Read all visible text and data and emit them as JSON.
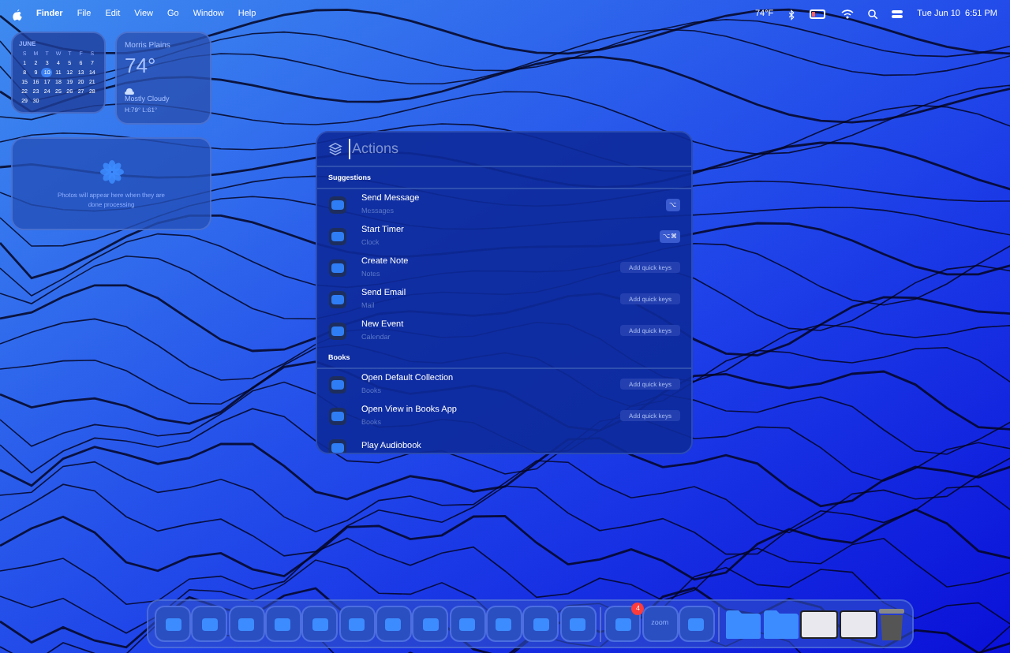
{
  "menu_bar": {
    "menus": [
      "Finder",
      "File",
      "Edit",
      "View",
      "Go",
      "Window",
      "Help"
    ],
    "weather": "74°F",
    "clock": "Tue Jun 10  6:51 PM"
  },
  "calendar_widget": {
    "month": "JUNE",
    "weekdays": [
      "S",
      "M",
      "T",
      "W",
      "T",
      "F",
      "S"
    ],
    "days": [
      {
        "label": "1",
        "selected": false
      },
      {
        "label": "2",
        "selected": false
      },
      {
        "label": "3",
        "selected": false
      },
      {
        "label": "4",
        "selected": false
      },
      {
        "label": "5",
        "selected": false
      },
      {
        "label": "6",
        "selected": false
      },
      {
        "label": "7",
        "selected": false
      },
      {
        "label": "8",
        "selected": false
      },
      {
        "label": "9",
        "selected": false
      },
      {
        "label": "10",
        "selected": true
      },
      {
        "label": "11",
        "selected": false
      },
      {
        "label": "12",
        "selected": false
      },
      {
        "label": "13",
        "selected": false
      },
      {
        "label": "14",
        "selected": false
      },
      {
        "label": "15",
        "selected": false
      },
      {
        "label": "16",
        "selected": false
      },
      {
        "label": "17",
        "selected": false
      },
      {
        "label": "18",
        "selected": false
      },
      {
        "label": "19",
        "selected": false
      },
      {
        "label": "20",
        "selected": false
      },
      {
        "label": "21",
        "selected": false
      },
      {
        "label": "22",
        "selected": false
      },
      {
        "label": "23",
        "selected": false
      },
      {
        "label": "24",
        "selected": false
      },
      {
        "label": "25",
        "selected": false
      },
      {
        "label": "26",
        "selected": false
      },
      {
        "label": "27",
        "selected": false
      },
      {
        "label": "28",
        "selected": false
      },
      {
        "label": "29",
        "selected": false
      },
      {
        "label": "30",
        "selected": false
      }
    ]
  },
  "weather_widget": {
    "location": "Morris Plains",
    "temperature": "74°",
    "condition": "Mostly Cloudy",
    "range": "H:79° L:61°"
  },
  "photos_widget": {
    "message": "Photos will appear here when they are done processing"
  },
  "actions_panel": {
    "placeholder": "Actions",
    "sections": [
      {
        "title": "Suggestions",
        "items": [
          {
            "title": "Send Message",
            "app": "Messages",
            "shortcut": "⌥"
          },
          {
            "title": "Start Timer",
            "app": "Clock",
            "shortcut": "⌥⌘"
          },
          {
            "title": "Create Note",
            "app": "Notes",
            "button": "Add quick keys"
          },
          {
            "title": "Send Email",
            "app": "Mail",
            "button": "Add quick keys"
          },
          {
            "title": "New Event",
            "app": "Calendar",
            "button": "Add quick keys"
          }
        ]
      },
      {
        "title": "Books",
        "items": [
          {
            "title": "Open Default Collection",
            "app": "Books",
            "button": "Add quick keys"
          },
          {
            "title": "Open View in Books App",
            "app": "Books",
            "button": "Add quick keys"
          },
          {
            "title": "Play Audiobook"
          }
        ]
      }
    ]
  },
  "dock": {
    "items": [
      {
        "kind": "app"
      },
      {
        "kind": "app"
      },
      {
        "kind": "app"
      },
      {
        "kind": "app"
      },
      {
        "kind": "app"
      },
      {
        "kind": "app"
      },
      {
        "kind": "app"
      },
      {
        "kind": "app"
      },
      {
        "kind": "app"
      },
      {
        "kind": "app"
      },
      {
        "kind": "app"
      },
      {
        "kind": "app"
      },
      {
        "kind": "separator"
      },
      {
        "kind": "app",
        "badge": "4"
      },
      {
        "kind": "app",
        "label": "zoom"
      },
      {
        "kind": "app"
      },
      {
        "kind": "separator"
      },
      {
        "kind": "folder"
      },
      {
        "kind": "folder"
      },
      {
        "kind": "window"
      },
      {
        "kind": "window"
      },
      {
        "kind": "trash"
      }
    ]
  }
}
